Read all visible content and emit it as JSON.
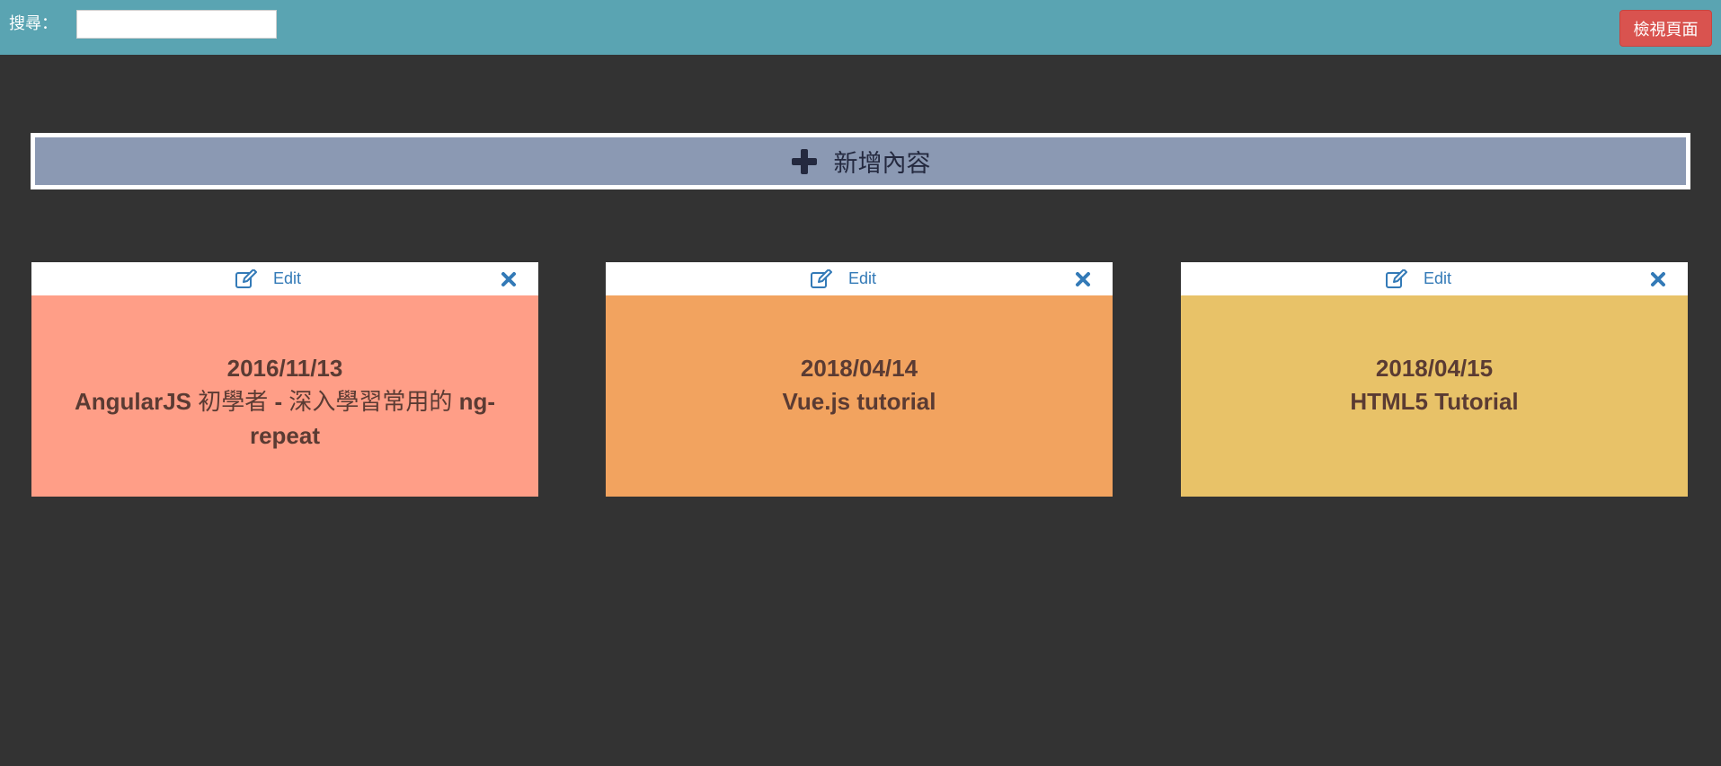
{
  "topbar": {
    "search_label": "搜尋：",
    "search_value": "",
    "search_placeholder": "",
    "view_button": "檢視頁面"
  },
  "add_panel": {
    "label": "新增內容",
    "icon": "plus-icon"
  },
  "cards": [
    {
      "edit_label": "Edit",
      "date": "2016/11/13",
      "title_parts": [
        "AngularJS ",
        "初學者",
        " - ",
        "深入學習常用的",
        " ng-repeat"
      ],
      "color": "#ff9e87"
    },
    {
      "edit_label": "Edit",
      "date": "2018/04/14",
      "title": "Vue.js tutorial",
      "color": "#f2a35f"
    },
    {
      "edit_label": "Edit",
      "date": "2018/04/15",
      "title": "HTML5 Tutorial",
      "color": "#e8c268"
    }
  ],
  "colors": {
    "topbar": "#5aa4b2",
    "background": "#333333",
    "view_button": "#d9534f",
    "add_panel": "#8b99b3",
    "link": "#337ab7",
    "card_text": "#5a3b33"
  }
}
